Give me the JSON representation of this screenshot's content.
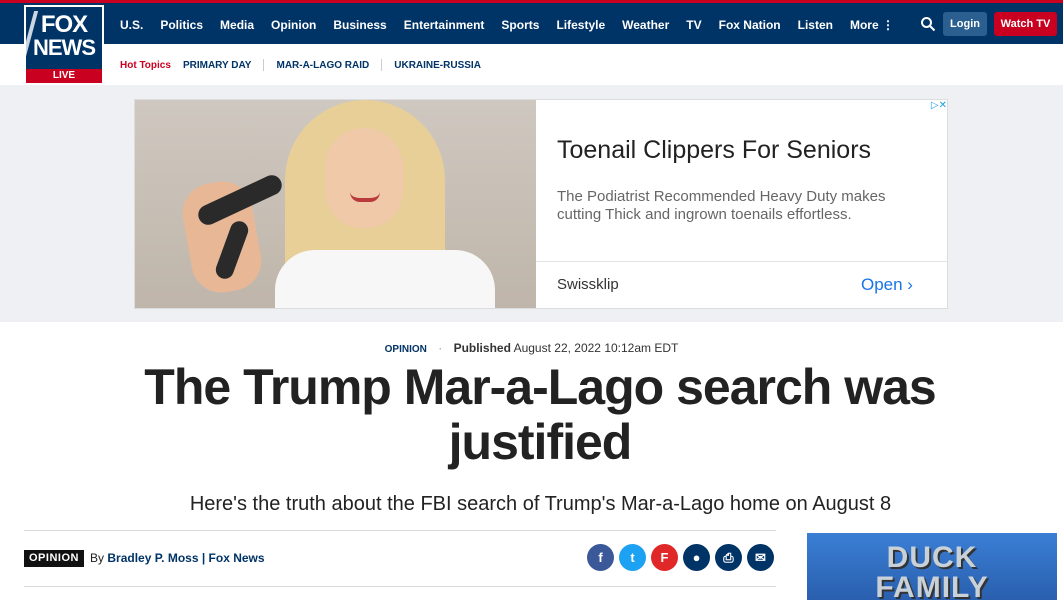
{
  "header": {
    "logo": {
      "line1": "FOX",
      "line2": "NEWS",
      "badge": "LIVE"
    },
    "nav": [
      "U.S.",
      "Politics",
      "Media",
      "Opinion",
      "Business",
      "Entertainment",
      "Sports",
      "Lifestyle",
      "Weather",
      "TV",
      "Fox Nation",
      "Listen",
      "More ⋮"
    ],
    "login_label": "Login",
    "watch_label": "Watch TV"
  },
  "subnav": {
    "hot_label": "Hot Topics",
    "topics": [
      "PRIMARY DAY",
      "MAR-A-LAGO RAID",
      "UKRAINE-RUSSIA"
    ]
  },
  "ad": {
    "title": "Toenail Clippers For Seniors",
    "description": "The Podiatrist Recommended Heavy Duty makes cutting Thick and ingrown toenails effortless.",
    "brand": "Swissklip",
    "cta": "Open ›",
    "choices": "▷✕"
  },
  "article": {
    "category": "OPINION",
    "published_label": "Published",
    "published_date": "August 22, 2022 10:12am EDT",
    "headline": "The Trump Mar-a-Lago search was justified",
    "subhead": "Here's the truth about the FBI search of Trump's Mar-a-Lago home on August 8",
    "badge": "OPINION",
    "by": "By",
    "author": "Bradley P. Moss",
    "outlet": "| Fox News"
  },
  "share": [
    {
      "name": "facebook",
      "glyph": "f",
      "color": "#3b5998"
    },
    {
      "name": "twitter",
      "glyph": "t",
      "color": "#1da1f2"
    },
    {
      "name": "flipboard",
      "glyph": "F",
      "color": "#e12828"
    },
    {
      "name": "comments",
      "glyph": "●",
      "color": "#003366"
    },
    {
      "name": "print",
      "glyph": "⎙",
      "color": "#003366"
    },
    {
      "name": "email",
      "glyph": "✉",
      "color": "#003366"
    }
  ],
  "sidebar_ad": {
    "line1": "DUCK",
    "line2": "FAMILY"
  }
}
